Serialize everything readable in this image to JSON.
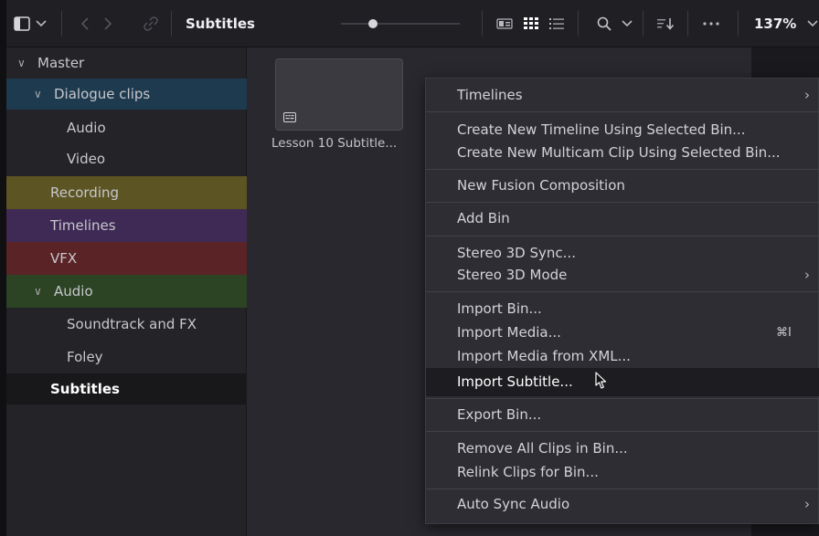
{
  "toolbar": {
    "title": "Subtitles",
    "zoom": "137%",
    "slider_value": 0.27
  },
  "sidebar": {
    "items": [
      {
        "label": "Master",
        "expanded": true,
        "level": 0,
        "color": ""
      },
      {
        "label": "Dialogue clips",
        "expanded": true,
        "level": 1,
        "color": "#1e3a4e"
      },
      {
        "label": "Audio",
        "level": 2,
        "color": ""
      },
      {
        "label": "Video",
        "level": 2,
        "color": ""
      },
      {
        "label": "Recording",
        "level": 1,
        "color": "#5c5423"
      },
      {
        "label": "Timelines",
        "level": 1,
        "color": "#3f2a55"
      },
      {
        "label": "VFX",
        "level": 1,
        "color": "#5a2326"
      },
      {
        "label": "Audio",
        "expanded": true,
        "level": 1,
        "color": "#2c4324"
      },
      {
        "label": "Soundtrack and FX",
        "level": 2,
        "color": ""
      },
      {
        "label": "Foley",
        "level": 2,
        "color": ""
      },
      {
        "label": "Subtitles",
        "level": 1,
        "color": "#18181b",
        "selected": true
      }
    ]
  },
  "content": {
    "clip_caption": "Lesson 10 Subtitle..."
  },
  "context_menu": {
    "items": [
      {
        "label": "Timelines",
        "submenu": true
      },
      {
        "label": "Create New Timeline Using Selected Bin..."
      },
      {
        "label": "Create New Multicam Clip Using Selected Bin..."
      },
      {
        "label": "New Fusion Composition"
      },
      {
        "label": "Add Bin"
      },
      {
        "label": "Stereo 3D Sync..."
      },
      {
        "label": "Stereo 3D Mode",
        "submenu": true
      },
      {
        "label": "Import Bin..."
      },
      {
        "label": "Import Media...",
        "shortcut": "⌘I"
      },
      {
        "label": "Import Media from XML..."
      },
      {
        "label": "Import Subtitle...",
        "highlighted": true
      },
      {
        "label": "Export Bin..."
      },
      {
        "label": "Remove All Clips in Bin..."
      },
      {
        "label": "Relink Clips for Bin..."
      },
      {
        "label": "Auto Sync Audio",
        "submenu": true
      }
    ]
  }
}
